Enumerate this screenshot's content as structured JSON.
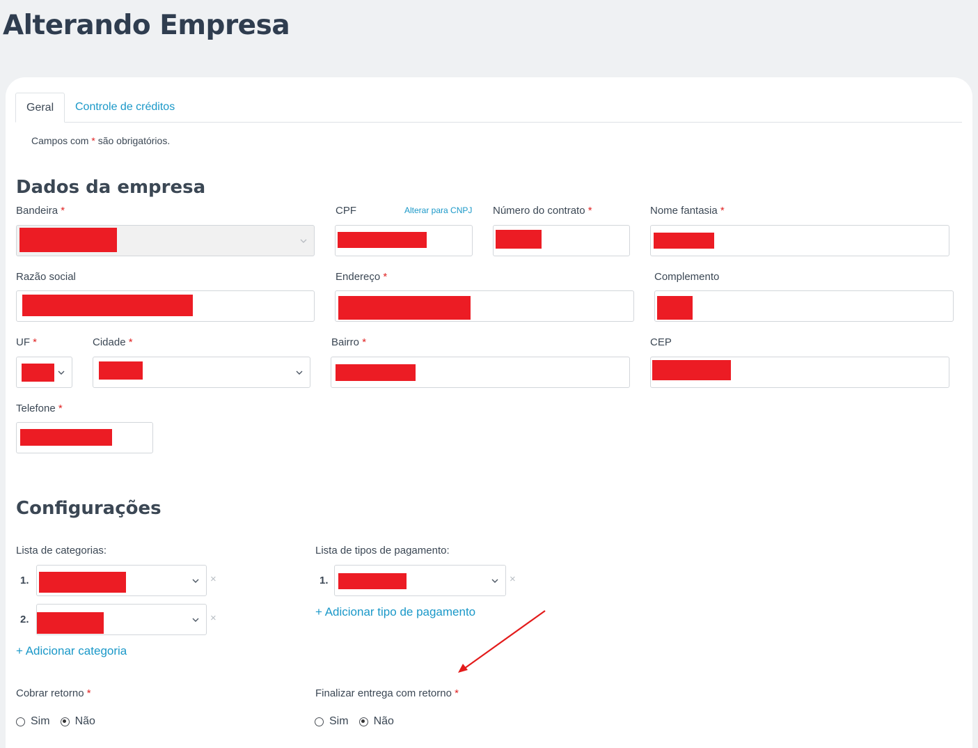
{
  "page": {
    "title": "Alterando Empresa"
  },
  "tabs": [
    {
      "label": "Geral",
      "active": true
    },
    {
      "label": "Controle de créditos",
      "active": false
    }
  ],
  "required_note": {
    "prefix": "Campos com ",
    "star": "*",
    "suffix": " são obrigatórios."
  },
  "dados": {
    "title": "Dados da empresa",
    "bandeira": {
      "label": "Bandeira",
      "star": "*"
    },
    "cpf": {
      "label": "CPF",
      "alt_link": "Alterar para CNPJ"
    },
    "numero_contrato": {
      "label": "Número do contrato",
      "star": "*"
    },
    "nome_fantasia": {
      "label": "Nome fantasia",
      "star": "*"
    },
    "razao_social": {
      "label": "Razão social"
    },
    "endereco": {
      "label": "Endereço",
      "star": "*"
    },
    "complemento": {
      "label": "Complemento"
    },
    "uf": {
      "label": "UF",
      "star": "*"
    },
    "cidade": {
      "label": "Cidade",
      "star": "*"
    },
    "bairro": {
      "label": "Bairro",
      "star": "*"
    },
    "cep": {
      "label": "CEP"
    },
    "telefone": {
      "label": "Telefone",
      "star": "*"
    }
  },
  "config": {
    "title": "Configurações",
    "categorias": {
      "label": "Lista de categorias:",
      "items": [
        {
          "num": "1."
        },
        {
          "num": "2."
        }
      ],
      "remove": "×",
      "add": "+ Adicionar categoria"
    },
    "pagamentos": {
      "label": "Lista de tipos de pagamento:",
      "items": [
        {
          "num": "1."
        }
      ],
      "remove": "×",
      "add": "+ Adicionar tipo de pagamento"
    },
    "cobrar_retorno": {
      "label": "Cobrar retorno",
      "star": "*",
      "options": [
        "Sim",
        "Não"
      ],
      "selected": "Não"
    },
    "finalizar_retorno": {
      "label": "Finalizar entrega com retorno",
      "star": "*",
      "options": [
        "Sim",
        "Não"
      ],
      "selected": "Não"
    }
  },
  "colors": {
    "redaction": "#ec1c24",
    "link": "#1a98c8",
    "required": "#e02323",
    "annotation_arrow": "#e31b1b"
  }
}
